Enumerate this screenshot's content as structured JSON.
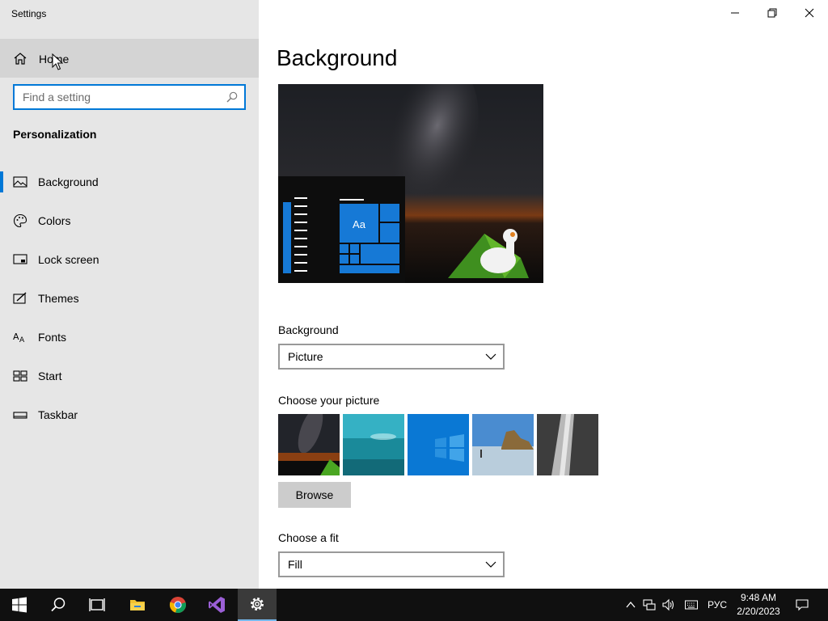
{
  "window": {
    "title": "Settings",
    "minimize_icon": "minimize-icon",
    "maximize_icon": "restore-icon",
    "close_icon": "close-icon"
  },
  "sidebar": {
    "home_label": "Home",
    "search_placeholder": "Find a setting",
    "section_title": "Personalization",
    "items": [
      {
        "label": "Background",
        "icon": "picture-icon",
        "selected": true
      },
      {
        "label": "Colors",
        "icon": "palette-icon",
        "selected": false
      },
      {
        "label": "Lock screen",
        "icon": "lock-screen-icon",
        "selected": false
      },
      {
        "label": "Themes",
        "icon": "themes-icon",
        "selected": false
      },
      {
        "label": "Fonts",
        "icon": "fonts-icon",
        "selected": false
      },
      {
        "label": "Start",
        "icon": "start-icon",
        "selected": false
      },
      {
        "label": "Taskbar",
        "icon": "taskbar-icon",
        "selected": false
      }
    ]
  },
  "main": {
    "title": "Background",
    "preview_tile_label": "Aa",
    "background_label": "Background",
    "background_value": "Picture",
    "choose_picture_label": "Choose your picture",
    "browse_label": "Browse",
    "fit_label": "Choose a fit",
    "fit_value": "Fill"
  },
  "taskbar": {
    "apps": [
      "start-icon",
      "search-icon",
      "task-view-icon",
      "file-explorer-icon",
      "chrome-icon",
      "visual-studio-icon",
      "settings-icon"
    ],
    "language": "РУС",
    "time": "9:48 AM",
    "date": "2/20/2023"
  },
  "colors": {
    "accent": "#0078d7",
    "sidebar_bg": "#e6e6e6",
    "taskbar_bg": "#101010"
  }
}
